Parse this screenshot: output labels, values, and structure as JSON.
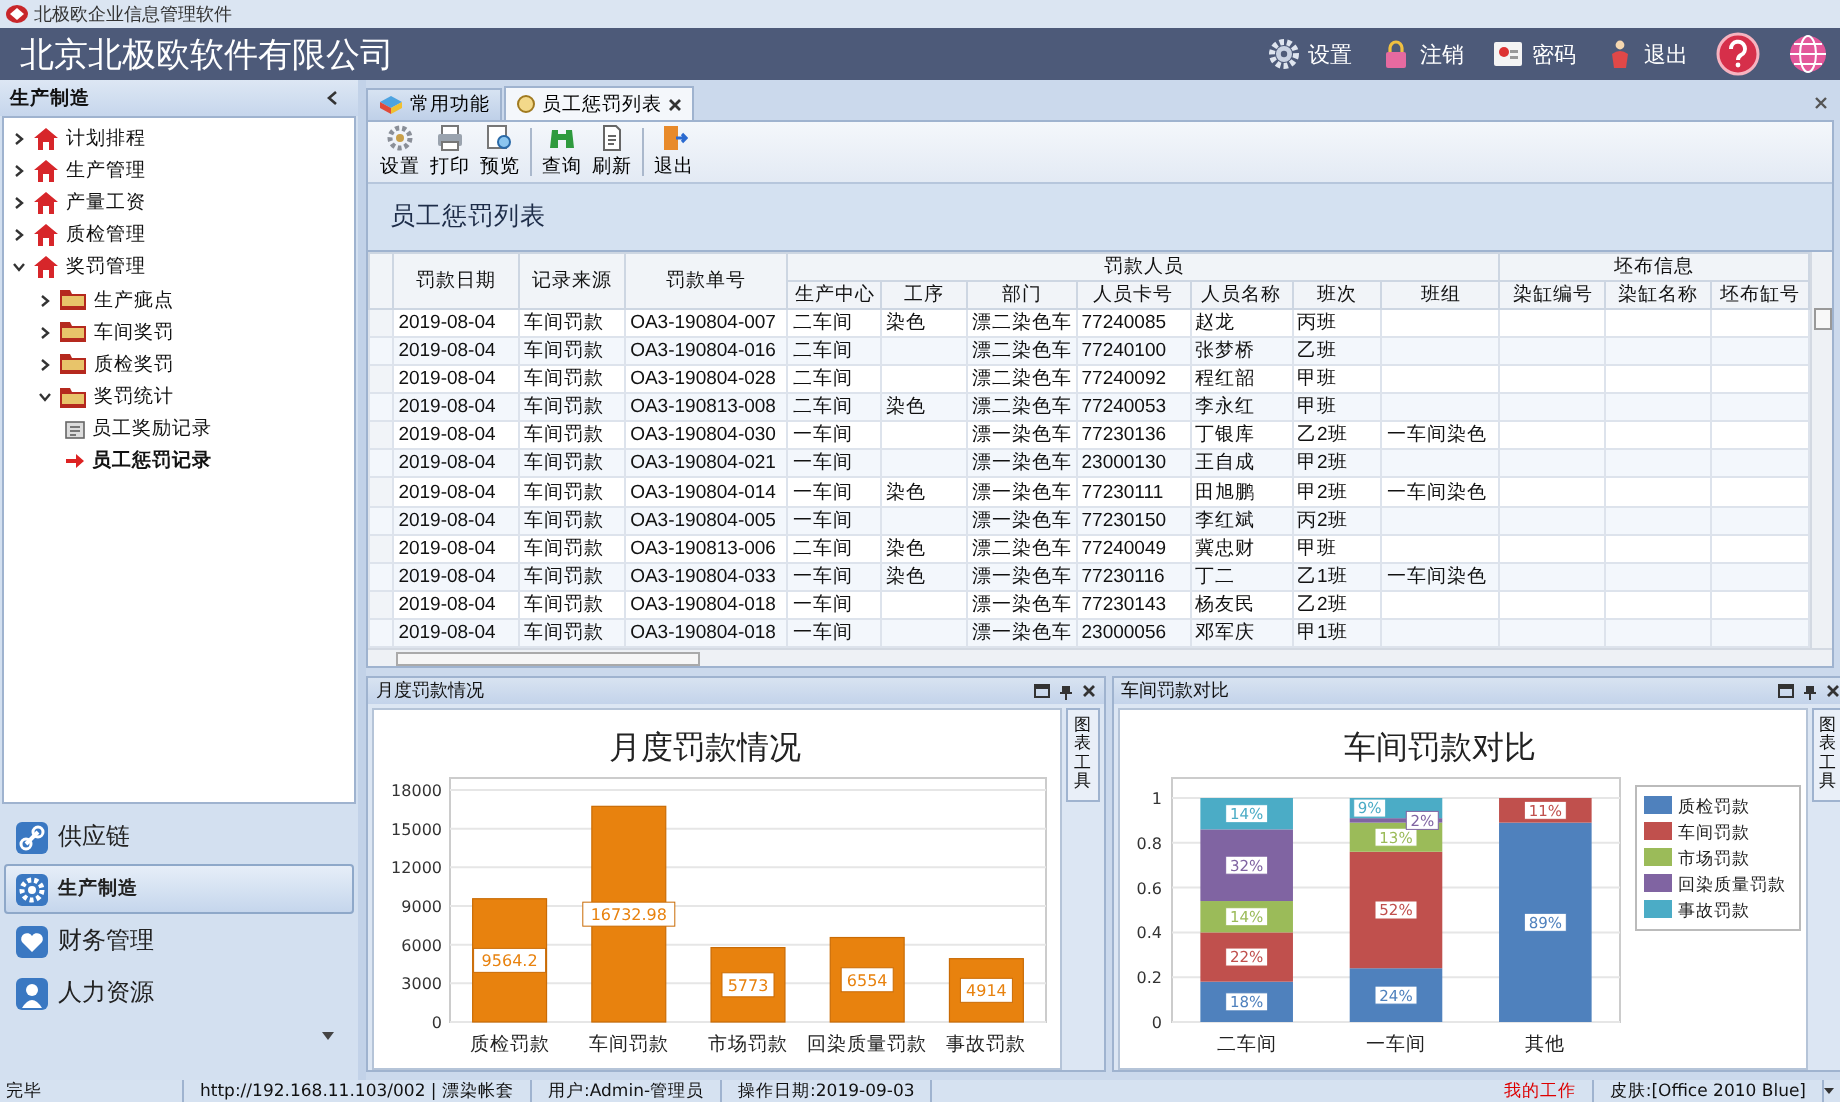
{
  "window": {
    "title": "北极欧企业信息管理软件"
  },
  "header": {
    "company": "北京北极欧软件有限公司",
    "actions": [
      {
        "label": "设置",
        "kind": "settings"
      },
      {
        "label": "注销",
        "kind": "lock"
      },
      {
        "label": "密码",
        "kind": "password"
      },
      {
        "label": "退出",
        "kind": "exit"
      }
    ]
  },
  "sidebar": {
    "title": "生产制造",
    "tree": [
      {
        "label": "计划排程",
        "expanded": false
      },
      {
        "label": "生产管理",
        "expanded": false
      },
      {
        "label": "产量工资",
        "expanded": false
      },
      {
        "label": "质检管理",
        "expanded": false
      },
      {
        "label": "奖罚管理",
        "expanded": true,
        "children": [
          {
            "label": "生产疵点",
            "expanded": false
          },
          {
            "label": "车间奖罚",
            "expanded": false
          },
          {
            "label": "质检奖罚",
            "expanded": false
          },
          {
            "label": "奖罚统计",
            "expanded": true,
            "children": [
              {
                "label": "员工奖励记录",
                "selected": false
              },
              {
                "label": "员工惩罚记录",
                "selected": true
              }
            ]
          }
        ]
      }
    ],
    "nav": [
      {
        "label": "供应链",
        "kind": "chain",
        "selected": false
      },
      {
        "label": "生产制造",
        "kind": "gear",
        "selected": true
      },
      {
        "label": "财务管理",
        "kind": "heart",
        "selected": false
      },
      {
        "label": "人力资源",
        "kind": "person",
        "selected": false
      }
    ]
  },
  "tabs": [
    {
      "label": "常用功能",
      "kind": "home",
      "selected": false
    },
    {
      "label": "员工惩罚列表",
      "kind": "list",
      "selected": true
    }
  ],
  "toolbar": [
    [
      {
        "label": "设置",
        "kind": "settings"
      },
      {
        "label": "打印",
        "kind": "print"
      },
      {
        "label": "预览",
        "kind": "preview"
      }
    ],
    [
      {
        "label": "查询",
        "kind": "find"
      },
      {
        "label": "刷新",
        "kind": "refresh"
      }
    ],
    [
      {
        "label": "退出",
        "kind": "exit"
      }
    ]
  ],
  "list_title": "员工惩罚列表",
  "table": {
    "columns": [
      {
        "kind": "single",
        "label": "罚款日期"
      },
      {
        "kind": "single",
        "label": "记录来源"
      },
      {
        "kind": "single",
        "label": "罚款单号"
      },
      {
        "kind": "group",
        "label": "罚款人员",
        "colspan": 7,
        "columns": [
          "生产中心",
          "工序",
          "部门",
          "人员卡号",
          "人员名称",
          "班次",
          "班组"
        ]
      },
      {
        "kind": "group",
        "label": "坯布信息",
        "colspan": 3,
        "columns": [
          "染缸编号",
          "染缸名称",
          "坯布缸号"
        ]
      }
    ],
    "rows": [
      [
        "2019-08-04",
        "车间罚款",
        "OA3-190804-007",
        "二车间",
        "染色",
        "漂二染色车",
        "77240085",
        "赵龙",
        "丙班",
        null,
        null,
        null,
        null
      ],
      [
        "2019-08-04",
        "车间罚款",
        "OA3-190804-016",
        "二车间",
        null,
        "漂二染色车",
        "77240100",
        "张梦桥",
        "乙班",
        null,
        null,
        null,
        null
      ],
      [
        "2019-08-04",
        "车间罚款",
        "OA3-190804-028",
        "二车间",
        null,
        "漂二染色车",
        "77240092",
        "程红韶",
        "甲班",
        null,
        null,
        null,
        null
      ],
      [
        "2019-08-04",
        "车间罚款",
        "OA3-190813-008",
        "二车间",
        "染色",
        "漂二染色车",
        "77240053",
        "李永红",
        "甲班",
        null,
        null,
        null,
        null
      ],
      [
        "2019-08-04",
        "车间罚款",
        "OA3-190804-030",
        "一车间",
        null,
        "漂一染色车",
        "77230136",
        "丁银库",
        "乙2班",
        "一车间染色",
        null,
        null,
        null
      ],
      [
        "2019-08-04",
        "车间罚款",
        "OA3-190804-021",
        "一车间",
        null,
        "漂一染色车",
        "23000130",
        "王自成",
        "甲2班",
        null,
        null,
        null,
        null
      ],
      [
        "2019-08-04",
        "车间罚款",
        "OA3-190804-014",
        "一车间",
        "染色",
        "漂一染色车",
        "77230111",
        "田旭鹏",
        "甲2班",
        "一车间染色",
        null,
        null,
        null
      ],
      [
        "2019-08-04",
        "车间罚款",
        "OA3-190804-005",
        "一车间",
        null,
        "漂一染色车",
        "77230150",
        "李红斌",
        "丙2班",
        null,
        null,
        null,
        null
      ],
      [
        "2019-08-04",
        "车间罚款",
        "OA3-190813-006",
        "二车间",
        "染色",
        "漂二染色车",
        "77240049",
        "冀忠财",
        "甲班",
        null,
        null,
        null,
        null
      ],
      [
        "2019-08-04",
        "车间罚款",
        "OA3-190804-033",
        "一车间",
        "染色",
        "漂一染色车",
        "77230116",
        "丁二",
        "乙1班",
        "一车间染色",
        null,
        null,
        null
      ],
      [
        "2019-08-04",
        "车间罚款",
        "OA3-190804-018",
        "一车间",
        null,
        "漂一染色车",
        "77230143",
        "杨友民",
        "乙2班",
        null,
        null,
        null,
        null
      ],
      [
        "2019-08-04",
        "车间罚款",
        "OA3-190804-018",
        "一车间",
        null,
        "漂一染色车",
        "23000056",
        "邓军庆",
        "甲1班",
        null,
        null,
        null,
        null
      ]
    ]
  },
  "monthly_panel": {
    "title": "月度罚款情况",
    "side_tab": "图表工具",
    "chart_data": {
      "type": "bar",
      "title": "月度罚款情况",
      "categories": [
        "质检罚款",
        "车间罚款",
        "市场罚款",
        "回染质量罚款",
        "事故罚款"
      ],
      "series": [
        {
          "color": "#e8820e",
          "values": [
            9564.2,
            16732.98,
            5773,
            6554,
            4914
          ]
        }
      ],
      "ylim": [
        0,
        18000
      ],
      "yticks": [
        0,
        3000,
        6000,
        9000,
        12000,
        15000,
        18000
      ],
      "grid": true,
      "data_labels": true
    }
  },
  "workshop_panel": {
    "title": "车间罚款对比",
    "side_tab": "图表工具",
    "chart_data": {
      "type": "bar",
      "title": "车间罚款对比",
      "stacked": true,
      "categories": [
        "二车间",
        "一车间",
        "其他"
      ],
      "series": [
        {
          "name": "质检罚款",
          "color": "#4f81bd",
          "values": [
            0.18,
            0.24,
            0.89
          ],
          "value_labels": [
            "18%",
            "24%",
            "89%"
          ]
        },
        {
          "name": "车间罚款",
          "color": "#c0504d",
          "values": [
            0.22,
            0.52,
            0.11
          ],
          "value_labels": [
            "22%",
            "52%",
            "11%"
          ]
        },
        {
          "name": "市场罚款",
          "color": "#9bbb59",
          "values": [
            0.14,
            0.13,
            null
          ],
          "value_labels": [
            "14%",
            "13%",
            null
          ]
        },
        {
          "name": "回染质量罚款",
          "color": "#8064a2",
          "values": [
            0.32,
            0.02,
            null
          ],
          "value_labels": [
            "32%",
            "2%",
            null
          ]
        },
        {
          "name": "事故罚款",
          "color": "#4bacc6",
          "values": [
            0.14,
            0.09,
            null
          ],
          "value_labels": [
            "14%",
            "9%",
            null
          ]
        }
      ],
      "ylim": [
        0,
        1
      ],
      "yticks": [
        0,
        0.2,
        0.4,
        0.6,
        0.8,
        1
      ],
      "grid": true,
      "legend": "right"
    }
  },
  "status_bar": {
    "state": "完毕",
    "server": "http://192.168.11.103/002 | 漂染帐套",
    "user": "用户:Admin-管理员",
    "date": "操作日期:2019-09-03",
    "my_work": "我的工作",
    "skin": "皮肤:[Office 2010 Blue]"
  }
}
